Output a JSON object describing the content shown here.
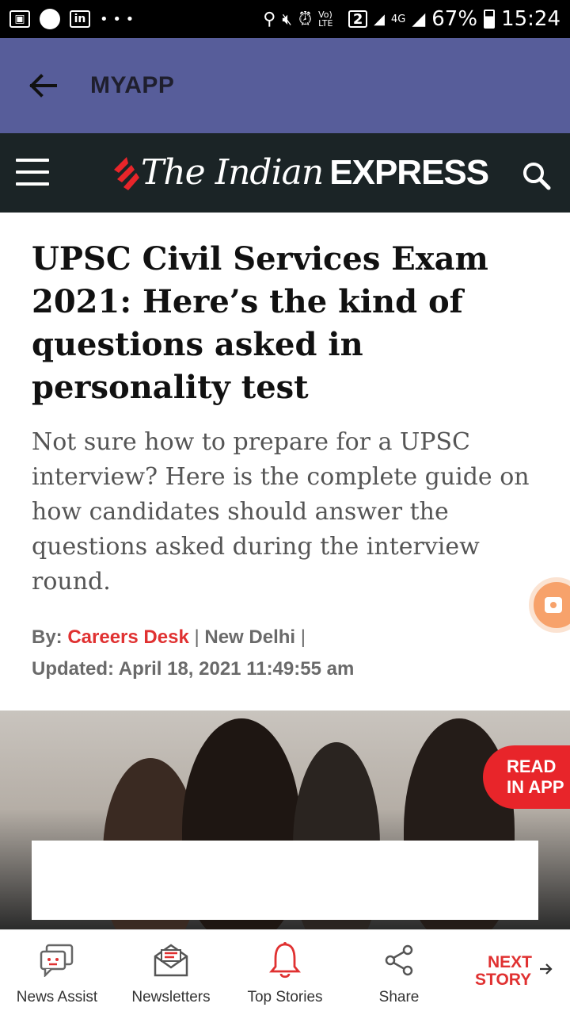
{
  "status_bar": {
    "battery": "67%",
    "time": "15:24",
    "sim_badge": "2",
    "network": "4G",
    "volte": "Vo) LTE"
  },
  "app_bar": {
    "title": "MYAPP"
  },
  "site_header": {
    "logo_italic": "The Indian",
    "logo_bold": "EXPRESS"
  },
  "article": {
    "headline": "UPSC Civil Services Exam 2021: Here’s the kind of questions asked in personality test",
    "summary": "Not sure how to prepare for a UPSC interview? Here is the complete guide on how candidates should answer the questions asked during the interview round.",
    "by_label": "By:",
    "author": "Careers Desk",
    "separator_1": "|",
    "location": "New Delhi",
    "separator_2": "|",
    "updated": "Updated: April 18, 2021 11:49:55 am"
  },
  "read_in_app": {
    "line1": "READ",
    "line2": "IN APP"
  },
  "bottom_nav": {
    "items": [
      {
        "label": "News Assist",
        "icon": "chat-bot-icon"
      },
      {
        "label": "Newsletters",
        "icon": "mail-icon"
      },
      {
        "label": "Top Stories",
        "icon": "bell-icon"
      },
      {
        "label": "Share",
        "icon": "share-icon"
      }
    ],
    "next_line1": "NEXT",
    "next_line2": "STORY"
  },
  "colors": {
    "app_bar": "#575d9a",
    "site_header": "#1b2426",
    "accent_red": "#e03131"
  }
}
